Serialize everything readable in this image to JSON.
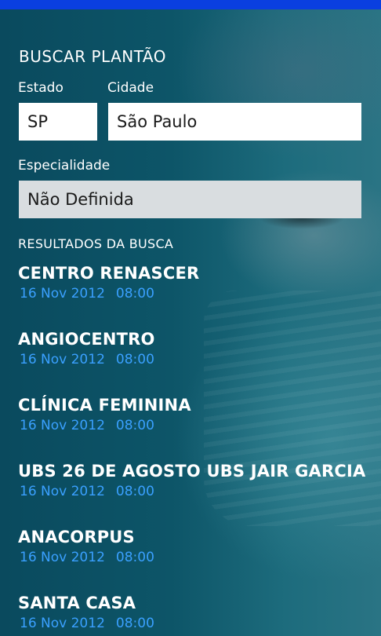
{
  "form": {
    "title": "BUSCAR PLANTÃO",
    "estado_label": "Estado",
    "estado_value": "SP",
    "cidade_label": "Cidade",
    "cidade_value": "São Paulo",
    "especialidade_label": "Especialidade",
    "especialidade_value": "Não Definida"
  },
  "results": {
    "title": "RESULTADOS DA BUSCA",
    "items": [
      {
        "name": "CENTRO RENASCER",
        "date": "16 Nov 2012",
        "time": "08:00"
      },
      {
        "name": "ANGIOCENTRO",
        "date": "16 Nov 2012",
        "time": "08:00"
      },
      {
        "name": "CLÍNICA FEMININA",
        "date": "16 Nov 2012",
        "time": "08:00"
      },
      {
        "name": "UBS 26 DE AGOSTO UBS JAIR GARCIA",
        "date": "16 Nov 2012",
        "time": "08:00"
      },
      {
        "name": "ANACORPUS",
        "date": "16 Nov 2012",
        "time": "08:00"
      },
      {
        "name": "SANTA CASA",
        "date": "16 Nov 2012",
        "time": "08:00"
      }
    ]
  },
  "colors": {
    "accent_bar": "#0a3fe0",
    "date_text": "#3aa0ff"
  }
}
